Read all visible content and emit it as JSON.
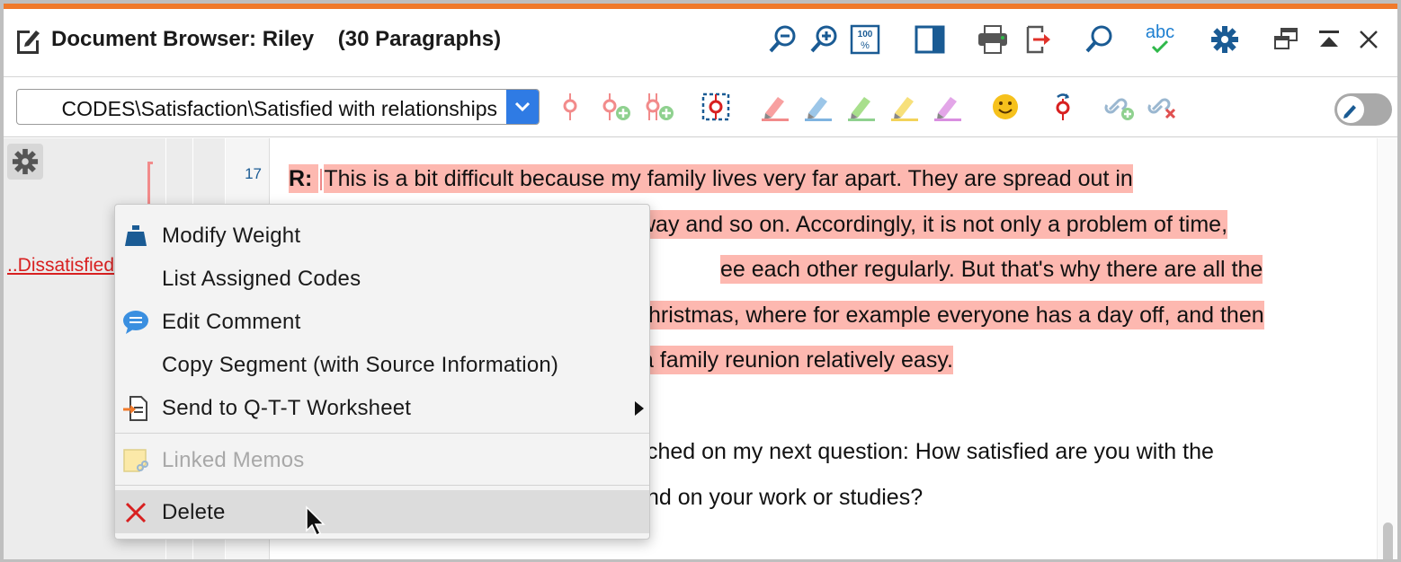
{
  "window": {
    "title": "Document Browser: Riley    (30 Paragraphs)"
  },
  "titlebar_icons": [
    "zoom-out-icon",
    "zoom-in-icon",
    "zoom-100-icon",
    "panel-toggle-icon",
    "print-icon",
    "export-icon",
    "search-icon",
    "spellcheck-icon",
    "settings-gear-icon",
    "undock-icon",
    "minimize-up-icon",
    "close-icon"
  ],
  "spellcheck_label": "abc",
  "zoom100_label": "100",
  "toolbar": {
    "code_path": "CODES\\Satisfaction\\Satisfied with relationships",
    "icons": [
      "code-pin-icon",
      "code-pin-add-icon",
      "code-multi-add-icon",
      "code-select-icon",
      "highlight-red-icon",
      "highlight-blue-icon",
      "highlight-green-icon",
      "highlight-yellow-icon",
      "highlight-purple-icon",
      "emoticon-icon",
      "recode-icon",
      "link-add-icon",
      "link-remove-icon"
    ],
    "edit_toggle": "off"
  },
  "gutter": {
    "code_label": "..Dissatisfied",
    "line_number": "17"
  },
  "document": {
    "speaker": "R:",
    "para1_lines": [
      "This is a bit difficult because my family lives very far apart. They are spread out in",
      "way and so on. Accordingly, it is not only a problem of time,",
      "ee each other regularly. But that's why there are all the",
      "hristmas, where for example everyone has a day off, and then",
      "a family reunion relatively easy."
    ],
    "para2_lines": [
      "ched on my next question: How satisfied are you with the",
      "nd on your work or studies?"
    ]
  },
  "context_menu": {
    "items": [
      {
        "label": "Modify Weight",
        "icon": "weight-icon",
        "enabled": true
      },
      {
        "label": "List Assigned Codes",
        "icon": "",
        "enabled": true
      },
      {
        "label": "Edit Comment",
        "icon": "comment-icon",
        "enabled": true
      },
      {
        "label": "Copy Segment (with Source Information)",
        "icon": "",
        "enabled": true
      },
      {
        "label": "Send to Q-T-T Worksheet",
        "icon": "send-worksheet-icon",
        "enabled": true,
        "submenu": true
      },
      {
        "label": "Linked Memos",
        "icon": "memo-link-icon",
        "enabled": false
      },
      {
        "label": "Delete",
        "icon": "delete-x-icon",
        "enabled": true,
        "hovered": true
      }
    ]
  },
  "colors": {
    "accent_orange": "#f07a2b",
    "highlight_red": "#fdb8b0",
    "toolbar_blue": "#1a5b94",
    "select_blue": "#2f7be4",
    "delete_red": "#d82020"
  }
}
